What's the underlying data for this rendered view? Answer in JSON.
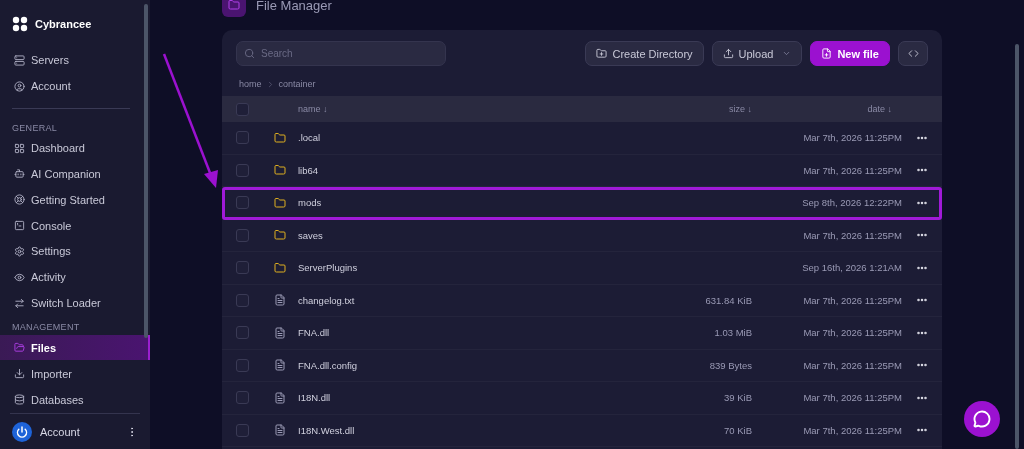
{
  "sidebar": {
    "brand": "Cybrancee",
    "top_items": [
      {
        "label": "Servers",
        "selected": false
      },
      {
        "label": "Account",
        "selected": false
      }
    ],
    "sections": [
      {
        "heading": "GENERAL",
        "items": [
          {
            "label": "Dashboard",
            "selected": false
          },
          {
            "label": "AI Companion",
            "selected": false
          },
          {
            "label": "Getting Started",
            "selected": false
          },
          {
            "label": "Console",
            "selected": false
          },
          {
            "label": "Settings",
            "selected": false
          },
          {
            "label": "Activity",
            "selected": false
          },
          {
            "label": "Switch Loader",
            "selected": false
          }
        ]
      },
      {
        "heading": "MANAGEMENT",
        "items": [
          {
            "label": "Files",
            "selected": true
          },
          {
            "label": "Importer",
            "selected": false
          },
          {
            "label": "Databases",
            "selected": false
          }
        ]
      }
    ],
    "footer": {
      "label": "Account"
    }
  },
  "page": {
    "title": "File Manager"
  },
  "toolbar": {
    "search": {
      "placeholder": "Search"
    },
    "buttons": [
      {
        "label": "Create Directory",
        "kind": "folder"
      },
      {
        "label": "Upload",
        "kind": "upload"
      },
      {
        "label": "New file",
        "kind": "primary"
      }
    ]
  },
  "breadcrumb": [
    "home",
    "container"
  ],
  "table": {
    "header_checked": false,
    "columns": [
      "name ↓",
      "size ↓",
      "date ↓"
    ],
    "rows": [
      {
        "name": ".local",
        "kind": "folder",
        "size": "",
        "date": "Mar 7th, 2026 11:25PM",
        "checked": false,
        "highlighted": false
      },
      {
        "name": "lib64",
        "kind": "folder",
        "size": "",
        "date": "Mar 7th, 2026 11:25PM",
        "checked": false,
        "highlighted": false
      },
      {
        "name": "mods",
        "kind": "folder",
        "size": "",
        "date": "Sep 8th, 2026 12:22PM",
        "checked": false,
        "highlighted": true
      },
      {
        "name": "saves",
        "kind": "folder",
        "size": "",
        "date": "Mar 7th, 2026 11:25PM",
        "checked": false,
        "highlighted": false
      },
      {
        "name": "ServerPlugins",
        "kind": "folder",
        "size": "",
        "date": "Sep 16th, 2026 1:21AM",
        "checked": false,
        "highlighted": false
      },
      {
        "name": "changelog.txt",
        "kind": "file",
        "size": "631.84 KiB",
        "date": "Mar 7th, 2026 11:25PM",
        "checked": false,
        "highlighted": false
      },
      {
        "name": "FNA.dll",
        "kind": "file",
        "size": "1.03 MiB",
        "date": "Mar 7th, 2026 11:25PM",
        "checked": false,
        "highlighted": false
      },
      {
        "name": "FNA.dll.config",
        "kind": "file",
        "size": "839 Bytes",
        "date": "Mar 7th, 2026 11:25PM",
        "checked": false,
        "highlighted": false
      },
      {
        "name": "I18N.dll",
        "kind": "file",
        "size": "39 KiB",
        "date": "Mar 7th, 2026 11:25PM",
        "checked": false,
        "highlighted": false
      },
      {
        "name": "I18N.West.dll",
        "kind": "file",
        "size": "70 KiB",
        "date": "Mar 7th, 2026 11:25PM",
        "checked": false,
        "highlighted": false
      }
    ]
  }
}
